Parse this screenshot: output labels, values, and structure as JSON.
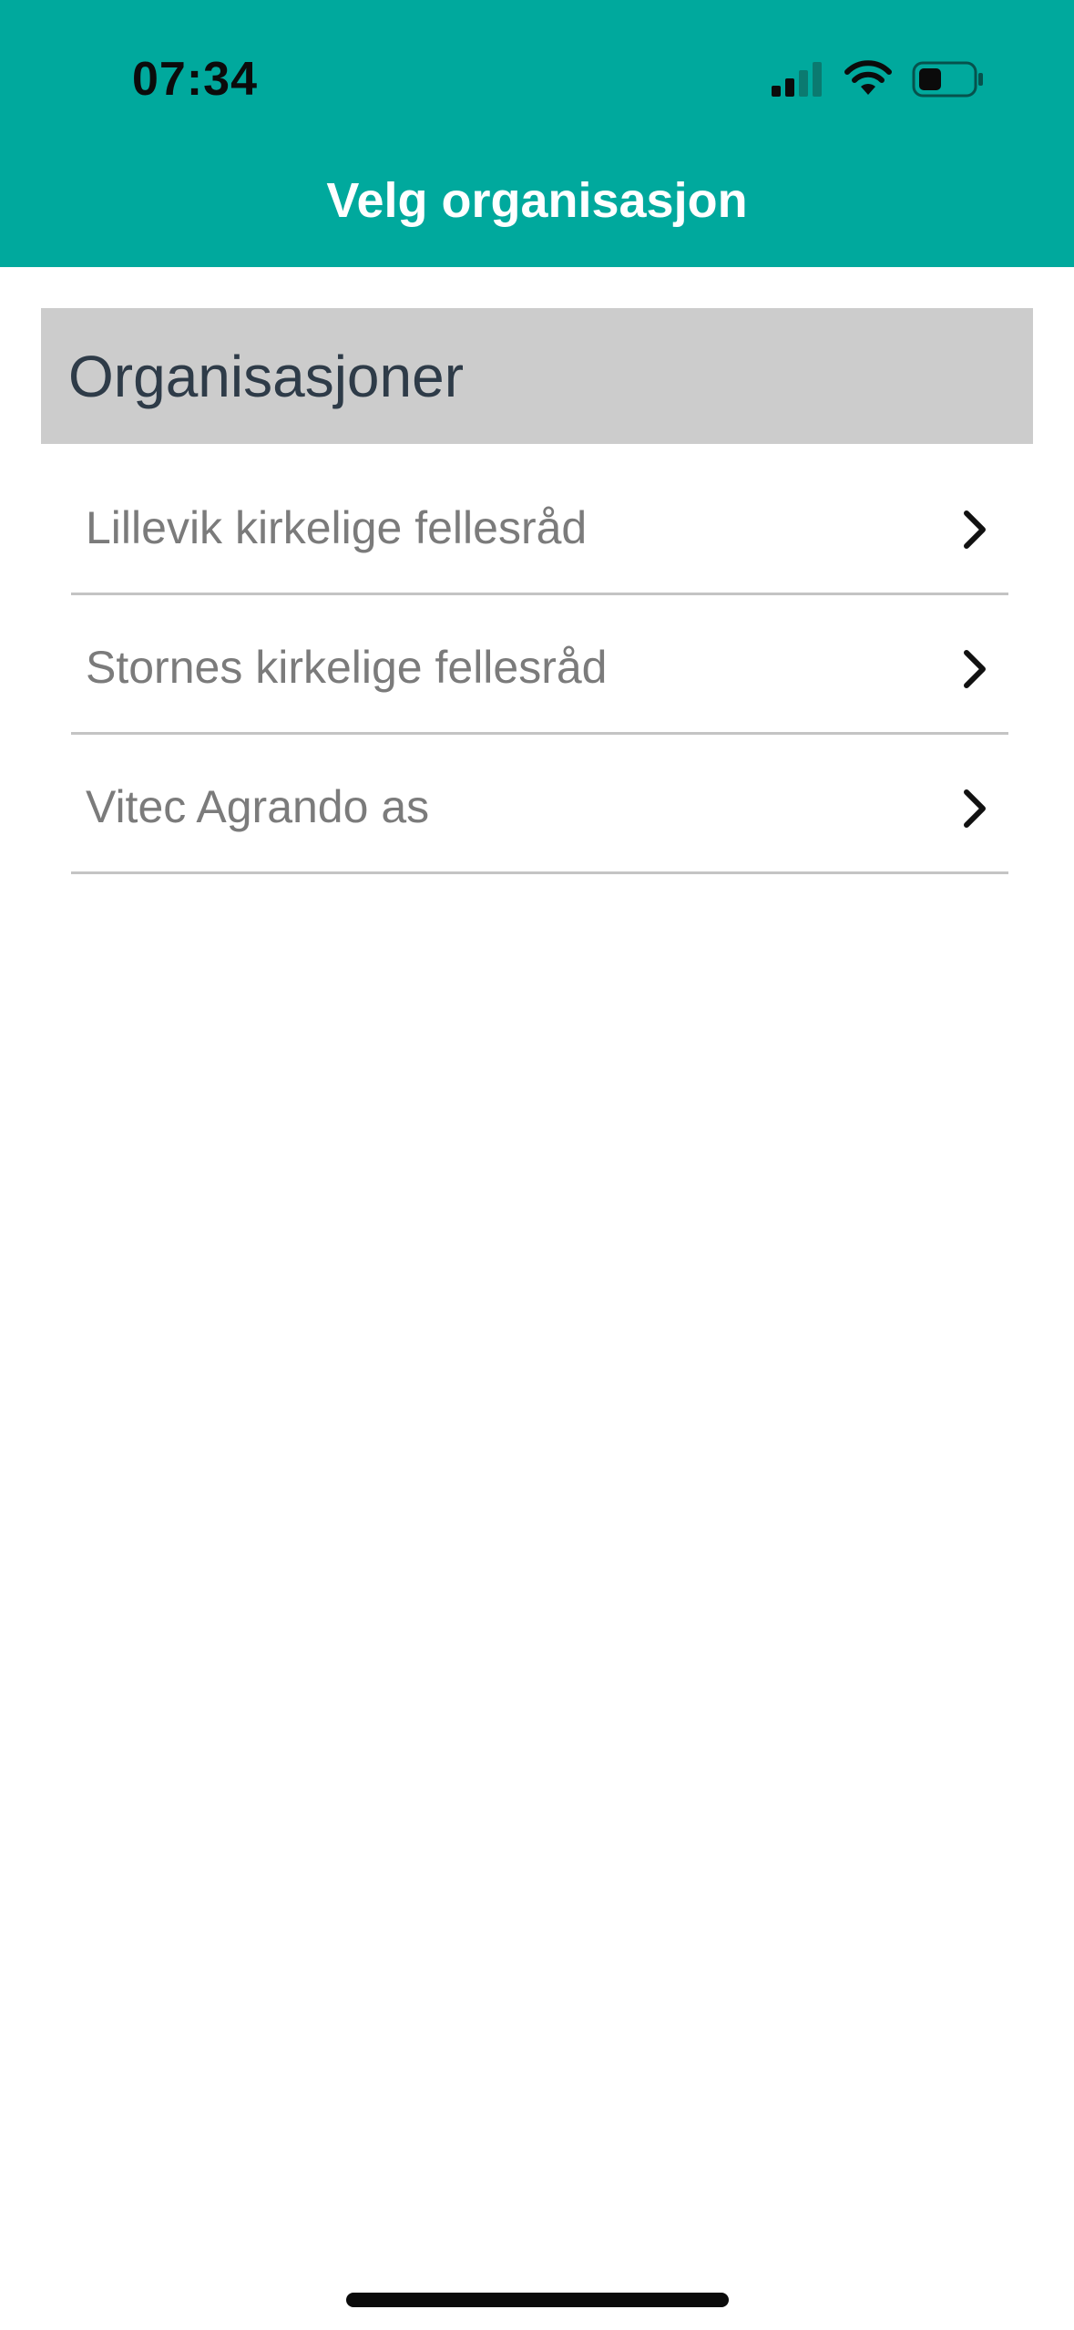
{
  "colors": {
    "header_bg": "#00a99d",
    "section_bg": "#cccccc",
    "home_indicator": "#0b0b0b"
  },
  "status_bar": {
    "time": "07:34",
    "icons": [
      "cellular-signal-icon",
      "wifi-icon",
      "battery-icon"
    ]
  },
  "nav": {
    "title": "Velg organisasjon"
  },
  "section": {
    "title": "Organisasjoner"
  },
  "organizations": [
    {
      "name": "Lillevik kirkelige fellesråd",
      "icon": "chevron-right-icon"
    },
    {
      "name": "Stornes kirkelige fellesråd",
      "icon": "chevron-right-icon"
    },
    {
      "name": "Vitec Agrando as",
      "icon": "chevron-right-icon"
    }
  ]
}
